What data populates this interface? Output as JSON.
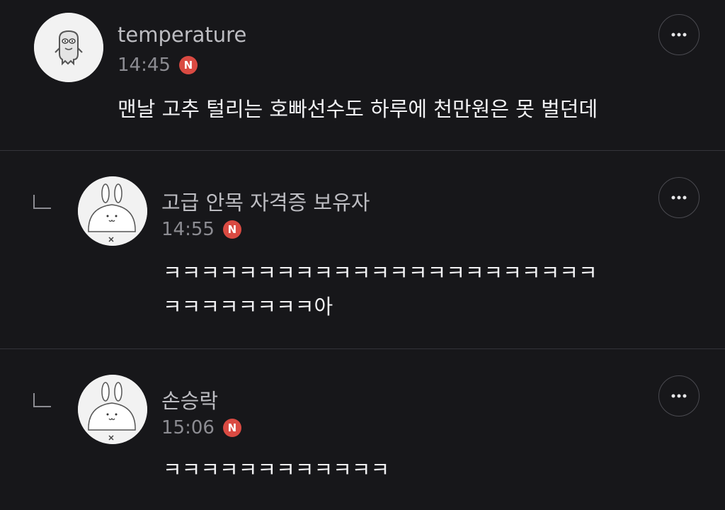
{
  "comments": [
    {
      "author": "temperature",
      "time": "14:45",
      "badge": "N",
      "lines": [
        "맨날 고추 털리는 호빠선수도 하루에 천만원은 못 벌던데"
      ],
      "avatar_icon": "ghost-character-icon",
      "more_icon": "more-options-icon",
      "is_reply": false
    },
    {
      "author": "고급 안목 자격증 보유자",
      "time": "14:55",
      "badge": "N",
      "lines": [
        "ㅋㅋㅋㅋㅋㅋㅋㅋㅋㅋㅋㅋㅋㅋㅋㅋㅋㅋㅋㅋㅋㅋㅋ",
        "ㅋㅋㅋㅋㅋㅋㅋㅋ아"
      ],
      "avatar_icon": "bunny-character-icon",
      "more_icon": "more-options-icon",
      "is_reply": true,
      "reply_icon": "reply-arrow-icon"
    },
    {
      "author": "손승락",
      "time": "15:06",
      "badge": "N",
      "lines": [
        "ㅋㅋㅋㅋㅋㅋㅋㅋㅋㅋㅋㅋ"
      ],
      "avatar_icon": "bunny-character-icon",
      "more_icon": "more-options-icon",
      "is_reply": true,
      "reply_icon": "reply-arrow-icon"
    }
  ],
  "colors": {
    "background": "#17171a",
    "divider": "#34343a",
    "badge": "#d94a42",
    "name": "#bdbdc2",
    "time": "#8c8c92",
    "text": "#f2f2f4"
  }
}
